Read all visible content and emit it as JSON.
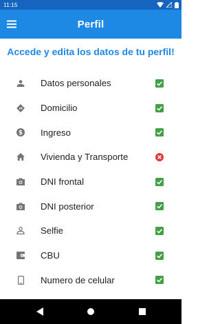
{
  "status_bar": {
    "time": "11:15",
    "icons": [
      "wifi-icon",
      "signal-icon",
      "battery-icon"
    ]
  },
  "app_bar": {
    "title": "Perfil",
    "menu_icon": "menu-icon"
  },
  "heading": "Accede y edita los datos de tu perfil!",
  "colors": {
    "status_bar": "#1565c0",
    "app_bar": "#1e88e5",
    "heading": "#1e88e5",
    "check": "#43a047",
    "error": "#e53935",
    "icon": "#757575"
  },
  "items": [
    {
      "label": "Datos personales",
      "icon": "person-icon",
      "status": "complete"
    },
    {
      "label": "Domicilio",
      "icon": "directions-icon",
      "status": "complete"
    },
    {
      "label": "Ingreso",
      "icon": "money-icon",
      "status": "complete"
    },
    {
      "label": "Vivienda y Transporte",
      "icon": "home-icon",
      "status": "error"
    },
    {
      "label": "DNI frontal",
      "icon": "camera-icon",
      "status": "complete"
    },
    {
      "label": "DNI posterior",
      "icon": "camera-icon",
      "status": "complete"
    },
    {
      "label": "Selfie",
      "icon": "person-outline-icon",
      "status": "complete"
    },
    {
      "label": "CBU",
      "icon": "wallet-icon",
      "status": "complete"
    },
    {
      "label": "Numero de celular",
      "icon": "phone-icon",
      "status": "complete"
    }
  ],
  "nav_bar": {
    "buttons": [
      "back-icon",
      "home-circle-icon",
      "recents-icon"
    ]
  }
}
